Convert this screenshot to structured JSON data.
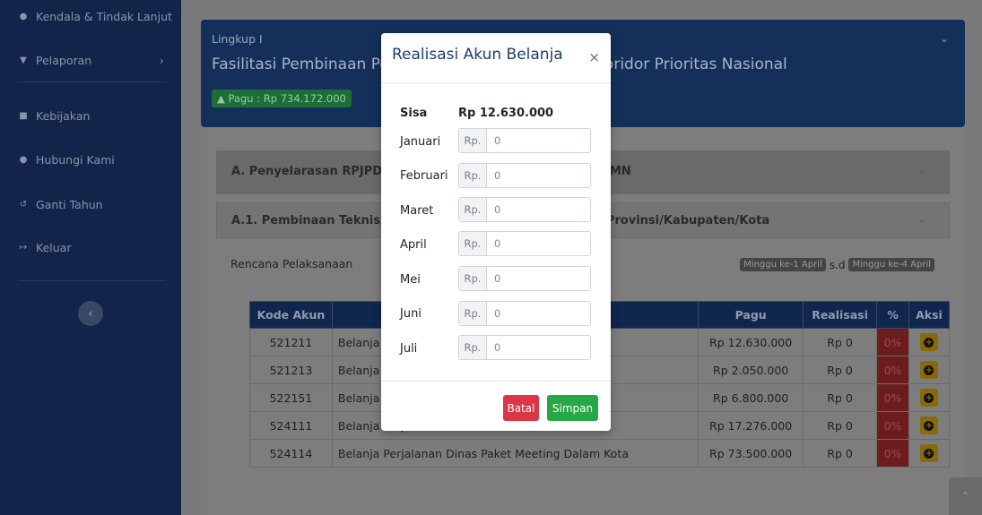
{
  "sidebar": {
    "items": [
      {
        "label": "Kendala & Tindak Lanjut",
        "icon": "info-icon"
      },
      {
        "label": "Pelaporan",
        "icon": "filter-icon"
      },
      {
        "label": "Kebijakan",
        "icon": "folder-icon"
      },
      {
        "label": "Hubungi Kami",
        "icon": "users-icon"
      },
      {
        "label": "Ganti Tahun",
        "icon": "history-icon"
      },
      {
        "label": "Keluar",
        "icon": "logout-icon"
      }
    ]
  },
  "banner": {
    "lingkup": "Lingkup I",
    "title": "Fasilitasi Pembinaan Pemerintahan Daerah dalam Koridor Prioritas Nasional",
    "pagu": "Pagu : Rp 734.172.000"
  },
  "sections": {
    "a": "A.  Penyelarasan RPJPD dan RPJMD dengan RPJPN dan RPJMN",
    "a1": "A.1. Pembinaan Teknis/Fasilitasi Penyelarasan Dokumen Provinsi/Kabupaten/Kota"
  },
  "rencana": {
    "label": "Rencana Pelaksanaan",
    "start": "Minggu ke-1 April",
    "sd": "s.d",
    "end": "Minggu ke-4 April"
  },
  "table": {
    "headers": [
      "Kode Akun",
      "",
      "Pagu",
      "Realisasi",
      "%",
      "Aksi"
    ],
    "rows": [
      {
        "kode": "521211",
        "uraian": "Belanja Bahan",
        "pagu": "Rp 12.630.000",
        "realisasi": "Rp 0",
        "pct": "0%"
      },
      {
        "kode": "521213",
        "uraian": "Belanja Honor Output Kegiatan",
        "pagu": "Rp 2.050.000",
        "realisasi": "Rp 0",
        "pct": "0%"
      },
      {
        "kode": "522151",
        "uraian": "Belanja Jasa Profesi",
        "pagu": "Rp 6.800.000",
        "realisasi": "Rp 0",
        "pct": "0%"
      },
      {
        "kode": "524111",
        "uraian": "Belanja Perjalanan Dinas Biasa",
        "pagu": "Rp 17.276.000",
        "realisasi": "Rp 0",
        "pct": "0%"
      },
      {
        "kode": "524114",
        "uraian": "Belanja Perjalanan Dinas Paket Meeting Dalam Kota",
        "pagu": "Rp 73.500.000",
        "realisasi": "Rp 0",
        "pct": "0%"
      }
    ]
  },
  "modal": {
    "title": "Realisasi Akun Belanja",
    "close": "×",
    "sisa_label": "Sisa",
    "sisa_value": "Rp 12.630.000",
    "prefix": "Rp.",
    "months": [
      {
        "label": "Januari",
        "value": "0"
      },
      {
        "label": "Februari",
        "value": "0"
      },
      {
        "label": "Maret",
        "value": "0"
      },
      {
        "label": "April",
        "value": "0"
      },
      {
        "label": "Mei",
        "value": "0"
      },
      {
        "label": "Juni",
        "value": "0"
      },
      {
        "label": "Juli",
        "value": "0"
      }
    ],
    "batal": "Batal",
    "simpan": "Simpan"
  },
  "colors": {
    "sidebar": "#12244a",
    "banner": "#14305a",
    "danger": "#dc3545",
    "success": "#28a745",
    "warning": "#ffc107"
  }
}
